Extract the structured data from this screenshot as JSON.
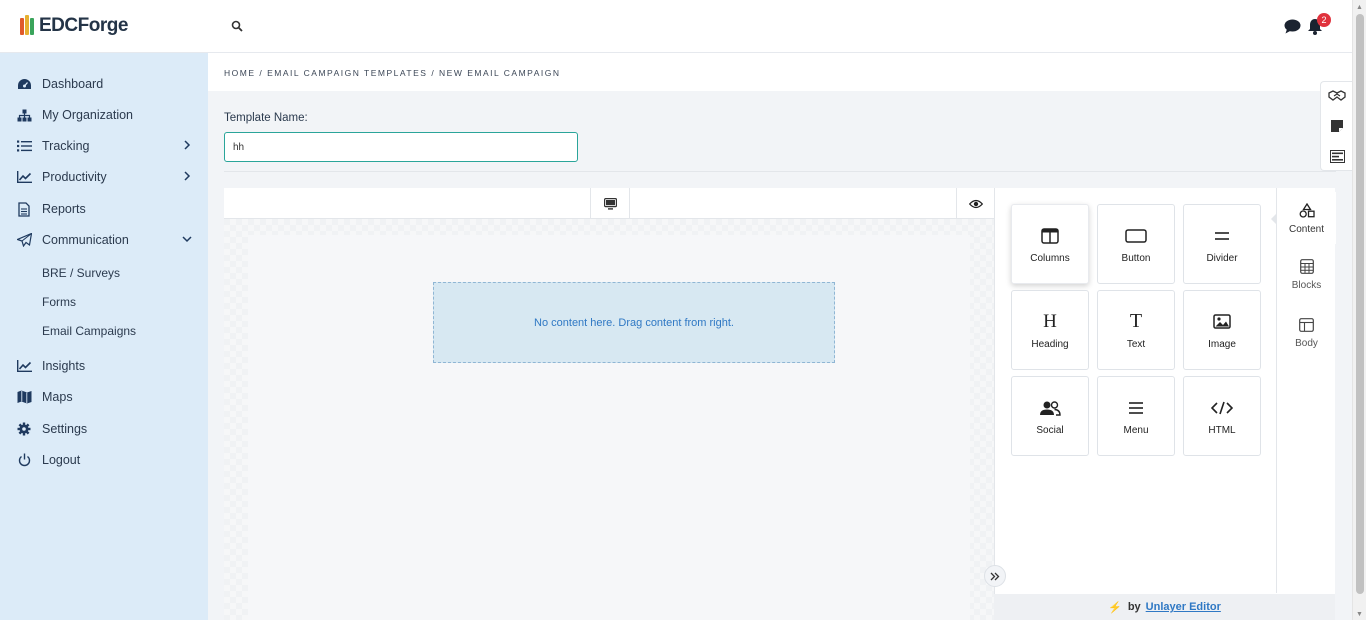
{
  "app": {
    "logo_text": "EDCForge",
    "notification_count": "2"
  },
  "sidebar": {
    "items": [
      {
        "label": "Dashboard",
        "icon": "dashboard-icon"
      },
      {
        "label": "My Organization",
        "icon": "org-chart-icon"
      },
      {
        "label": "Tracking",
        "icon": "list-icon",
        "chevron": "right"
      },
      {
        "label": "Productivity",
        "icon": "trend-chart-icon",
        "chevron": "right"
      },
      {
        "label": "Reports",
        "icon": "document-icon"
      },
      {
        "label": "Communication",
        "icon": "paper-plane-icon",
        "chevron": "down"
      },
      {
        "label": "Insights",
        "icon": "trend-chart-icon"
      },
      {
        "label": "Maps",
        "icon": "map-icon"
      },
      {
        "label": "Settings",
        "icon": "gear-icon"
      },
      {
        "label": "Logout",
        "icon": "power-icon"
      }
    ],
    "sub_items": [
      "BRE / Surveys",
      "Forms",
      "Email Campaigns"
    ]
  },
  "breadcrumb": "HOME / EMAIL CAMPAIGN TEMPLATES / NEW EMAIL CAMPAIGN",
  "template": {
    "label": "Template Name:",
    "value": "hh"
  },
  "editor": {
    "dropzone_text": "No content here. Drag content from right.",
    "tools": [
      "Columns",
      "Button",
      "Divider",
      "Heading",
      "Text",
      "Image",
      "Social",
      "Menu",
      "HTML"
    ],
    "tabs": [
      "Content",
      "Blocks",
      "Body"
    ],
    "powered_by_prefix": "by",
    "powered_by_brand": "Unlayer Editor"
  },
  "colors": {
    "sidebar_bg": "#dcebf8",
    "accent": "#2aa59a",
    "link": "#2f78c4",
    "badge": "#e0323d"
  }
}
